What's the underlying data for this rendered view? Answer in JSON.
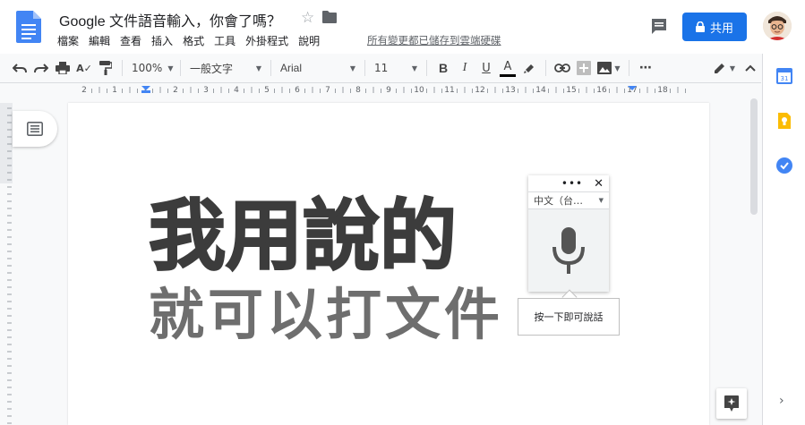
{
  "header": {
    "title": "Google 文件語音輸入，你會了嗎？",
    "saved_status": "所有變更都已儲存到雲端硬碟",
    "share_label": "共用",
    "menu": [
      "檔案",
      "編輯",
      "查看",
      "插入",
      "格式",
      "工具",
      "外掛程式",
      "說明"
    ]
  },
  "toolbar": {
    "zoom": "100%",
    "style": "一般文字",
    "font": "Arial",
    "size": "11",
    "bold": "B",
    "italic": "I",
    "underline": "U",
    "text_color": "A",
    "more": "⋯"
  },
  "ruler": {
    "ticks": [
      "2",
      "1",
      "1",
      "2",
      "3",
      "4",
      "5",
      "6",
      "7",
      "8",
      "9",
      "10",
      "11",
      "12",
      "13",
      "14",
      "15",
      "16",
      "17",
      "18"
    ]
  },
  "document": {
    "line1": "我用說的",
    "line2": "就可以打文件"
  },
  "voice": {
    "language": "中文（台…",
    "tooltip": "按一下即可說話"
  },
  "colors": {
    "accent": "#1a73e8",
    "doc_blue": "#4285f4"
  }
}
